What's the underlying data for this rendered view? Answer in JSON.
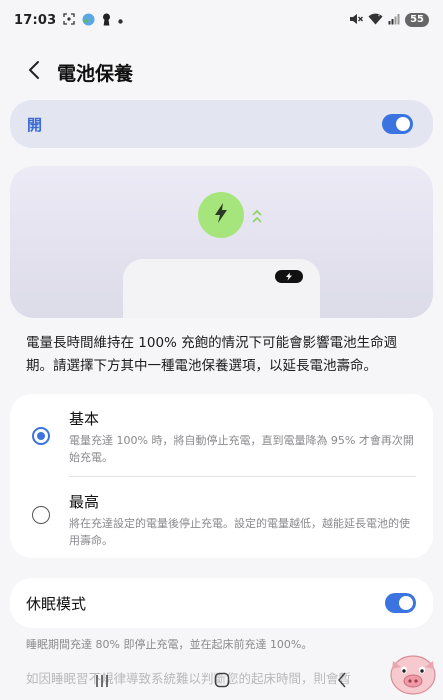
{
  "status_bar": {
    "time": "17:03",
    "battery_level": "55",
    "icons": [
      "screenshot-icon",
      "globe-icon",
      "keyhole-icon",
      "dot-icon",
      "mute-icon",
      "wifi-icon",
      "signal-icon"
    ]
  },
  "header": {
    "title": "電池保養",
    "back_icon": "chevron-left-icon"
  },
  "master_switch": {
    "label": "開",
    "enabled": true
  },
  "illustration": {
    "charge_icon": "lightning-icon",
    "accent": "#a6e57c"
  },
  "description": "電量長時間維持在 100% 充飽的情況下可能會影響電池生命週期。請選擇下方其中一種電池保養選項，以延長電池壽命。",
  "options": [
    {
      "title": "基本",
      "desc": "電量充達 100% 時，將自動停止充電，直到電量降為 95% 才會再次開始充電。",
      "selected": true
    },
    {
      "title": "最高",
      "desc": "將在充達設定的電量後停止充電。設定的電量越低，越能延長電池的使用壽命。",
      "selected": false
    }
  ],
  "sleep_mode": {
    "label": "休眠模式",
    "enabled": true,
    "desc": "睡眠期間充達 80% 即停止充電，並在起床前充達 100%。",
    "desc2": "如因睡眠習不規律導致系統難以判斷您的起床時間，則會暫"
  },
  "colors": {
    "accent": "#3b74e0",
    "card_tint": "#e3e6f1"
  },
  "nav": {
    "icons": [
      "recents-icon",
      "home-icon",
      "back-icon"
    ]
  }
}
